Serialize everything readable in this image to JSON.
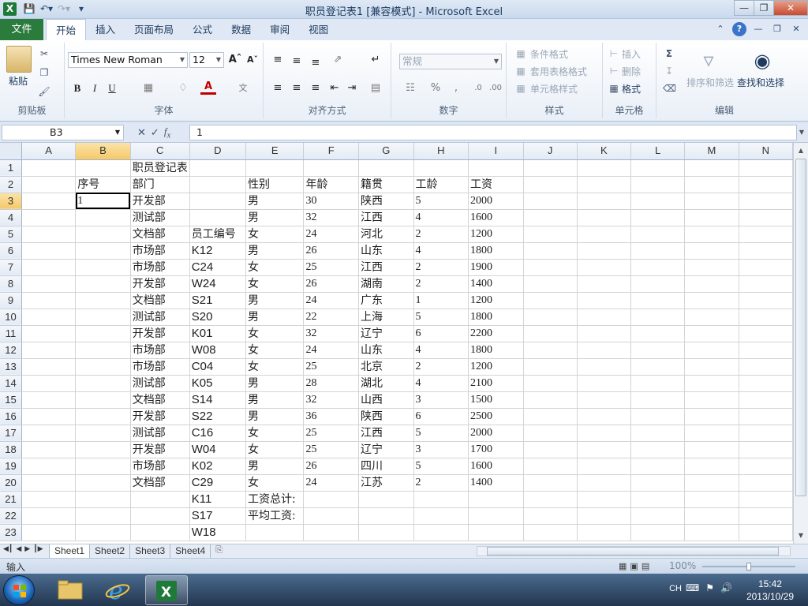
{
  "window": {
    "title": "职员登记表1 [兼容模式] - Microsoft Excel",
    "app_icon_letter": "X"
  },
  "tabs": {
    "file": "文件",
    "items": [
      "开始",
      "插入",
      "页面布局",
      "公式",
      "数据",
      "审阅",
      "视图"
    ],
    "active_index": 0
  },
  "ribbon": {
    "clipboard": {
      "paste": "粘贴",
      "label": "剪贴板"
    },
    "font": {
      "name": "Times New Roman",
      "size": "12",
      "label": "字体"
    },
    "alignment": {
      "label": "对齐方式"
    },
    "number": {
      "format": "常规",
      "percent": "%",
      "comma": ",",
      "label": "数字"
    },
    "styles": {
      "conditional": "条件格式",
      "table": "套用表格格式",
      "cell": "单元格样式",
      "label": "样式"
    },
    "cells": {
      "insert": "插入",
      "delete": "删除",
      "format": "格式",
      "label": "单元格"
    },
    "editing": {
      "sort": "排序和筛选",
      "find": "查找和选择",
      "label": "编辑"
    }
  },
  "formula_bar": {
    "name_box": "B3",
    "value": "1"
  },
  "grid": {
    "columns": [
      "A",
      "B",
      "C",
      "D",
      "E",
      "F",
      "G",
      "H",
      "I",
      "J",
      "K",
      "L",
      "M",
      "N"
    ],
    "selected_column": "B",
    "selected_row": 3,
    "rows": [
      {
        "n": "1",
        "cells": [
          "",
          "",
          "职员登记表",
          "",
          "",
          "",
          "",
          "",
          "",
          "",
          "",
          "",
          "",
          ""
        ]
      },
      {
        "n": "2",
        "cells": [
          "",
          "序号",
          "部门",
          "",
          "性别",
          "年龄",
          "籍贯",
          "工龄",
          "工资",
          "",
          "",
          "",
          "",
          ""
        ]
      },
      {
        "n": "3",
        "cells": [
          "",
          "1",
          "开发部",
          "",
          "男",
          "30",
          "陕西",
          "5",
          "2000",
          "",
          "",
          "",
          "",
          ""
        ]
      },
      {
        "n": "4",
        "cells": [
          "",
          "",
          "测试部",
          "",
          "男",
          "32",
          "江西",
          "4",
          "1600",
          "",
          "",
          "",
          "",
          ""
        ]
      },
      {
        "n": "5",
        "cells": [
          "",
          "",
          "文档部",
          "员工编号",
          "女",
          "24",
          "河北",
          "2",
          "1200",
          "",
          "",
          "",
          "",
          ""
        ]
      },
      {
        "n": "6",
        "cells": [
          "",
          "",
          "市场部",
          "K12",
          "男",
          "26",
          "山东",
          "4",
          "1800",
          "",
          "",
          "",
          "",
          ""
        ]
      },
      {
        "n": "7",
        "cells": [
          "",
          "",
          "市场部",
          "C24",
          "女",
          "25",
          "江西",
          "2",
          "1900",
          "",
          "",
          "",
          "",
          ""
        ]
      },
      {
        "n": "8",
        "cells": [
          "",
          "",
          "开发部",
          "W24",
          "女",
          "26",
          "湖南",
          "2",
          "1400",
          "",
          "",
          "",
          "",
          ""
        ]
      },
      {
        "n": "9",
        "cells": [
          "",
          "",
          "文档部",
          "S21",
          "男",
          "24",
          "广东",
          "1",
          "1200",
          "",
          "",
          "",
          "",
          ""
        ]
      },
      {
        "n": "10",
        "cells": [
          "",
          "",
          "测试部",
          "S20",
          "男",
          "22",
          "上海",
          "5",
          "1800",
          "",
          "",
          "",
          "",
          ""
        ]
      },
      {
        "n": "11",
        "cells": [
          "",
          "",
          "开发部",
          "K01",
          "女",
          "32",
          "辽宁",
          "6",
          "2200",
          "",
          "",
          "",
          "",
          ""
        ]
      },
      {
        "n": "12",
        "cells": [
          "",
          "",
          "市场部",
          "W08",
          "女",
          "24",
          "山东",
          "4",
          "1800",
          "",
          "",
          "",
          "",
          ""
        ]
      },
      {
        "n": "13",
        "cells": [
          "",
          "",
          "市场部",
          "C04",
          "女",
          "25",
          "北京",
          "2",
          "1200",
          "",
          "",
          "",
          "",
          ""
        ]
      },
      {
        "n": "14",
        "cells": [
          "",
          "",
          "测试部",
          "K05",
          "男",
          "28",
          "湖北",
          "4",
          "2100",
          "",
          "",
          "",
          "",
          ""
        ]
      },
      {
        "n": "15",
        "cells": [
          "",
          "",
          "文档部",
          "S14",
          "男",
          "32",
          "山西",
          "3",
          "1500",
          "",
          "",
          "",
          "",
          ""
        ]
      },
      {
        "n": "16",
        "cells": [
          "",
          "",
          "开发部",
          "S22",
          "男",
          "36",
          "陕西",
          "6",
          "2500",
          "",
          "",
          "",
          "",
          ""
        ]
      },
      {
        "n": "17",
        "cells": [
          "",
          "",
          "测试部",
          "C16",
          "女",
          "25",
          "江西",
          "5",
          "2000",
          "",
          "",
          "",
          "",
          ""
        ]
      },
      {
        "n": "18",
        "cells": [
          "",
          "",
          "开发部",
          "W04",
          "女",
          "25",
          "辽宁",
          "3",
          "1700",
          "",
          "",
          "",
          "",
          ""
        ]
      },
      {
        "n": "19",
        "cells": [
          "",
          "",
          "市场部",
          "K02",
          "男",
          "26",
          "四川",
          "5",
          "1600",
          "",
          "",
          "",
          "",
          ""
        ]
      },
      {
        "n": "20",
        "cells": [
          "",
          "",
          "文档部",
          "C29",
          "女",
          "24",
          "江苏",
          "2",
          "1400",
          "",
          "",
          "",
          "",
          ""
        ]
      },
      {
        "n": "21",
        "cells": [
          "",
          "",
          "",
          "K11",
          "工资总计:",
          "",
          "",
          "",
          "",
          "",
          "",
          "",
          "",
          ""
        ]
      },
      {
        "n": "22",
        "cells": [
          "",
          "",
          "",
          "S17",
          "平均工资:",
          "",
          "",
          "",
          "",
          "",
          "",
          "",
          "",
          ""
        ]
      },
      {
        "n": "23",
        "cells": [
          "",
          "",
          "",
          "W18",
          "",
          "",
          "",
          "",
          "",
          "",
          "",
          "",
          "",
          ""
        ]
      }
    ]
  },
  "sheets": [
    "Sheet1",
    "Sheet2",
    "Sheet3",
    "Sheet4"
  ],
  "active_sheet": "Sheet1",
  "status": {
    "mode": "输入",
    "zoom": "100%"
  },
  "taskbar": {
    "lang": "CH",
    "time": "15:42",
    "date": "2013/10/29"
  }
}
